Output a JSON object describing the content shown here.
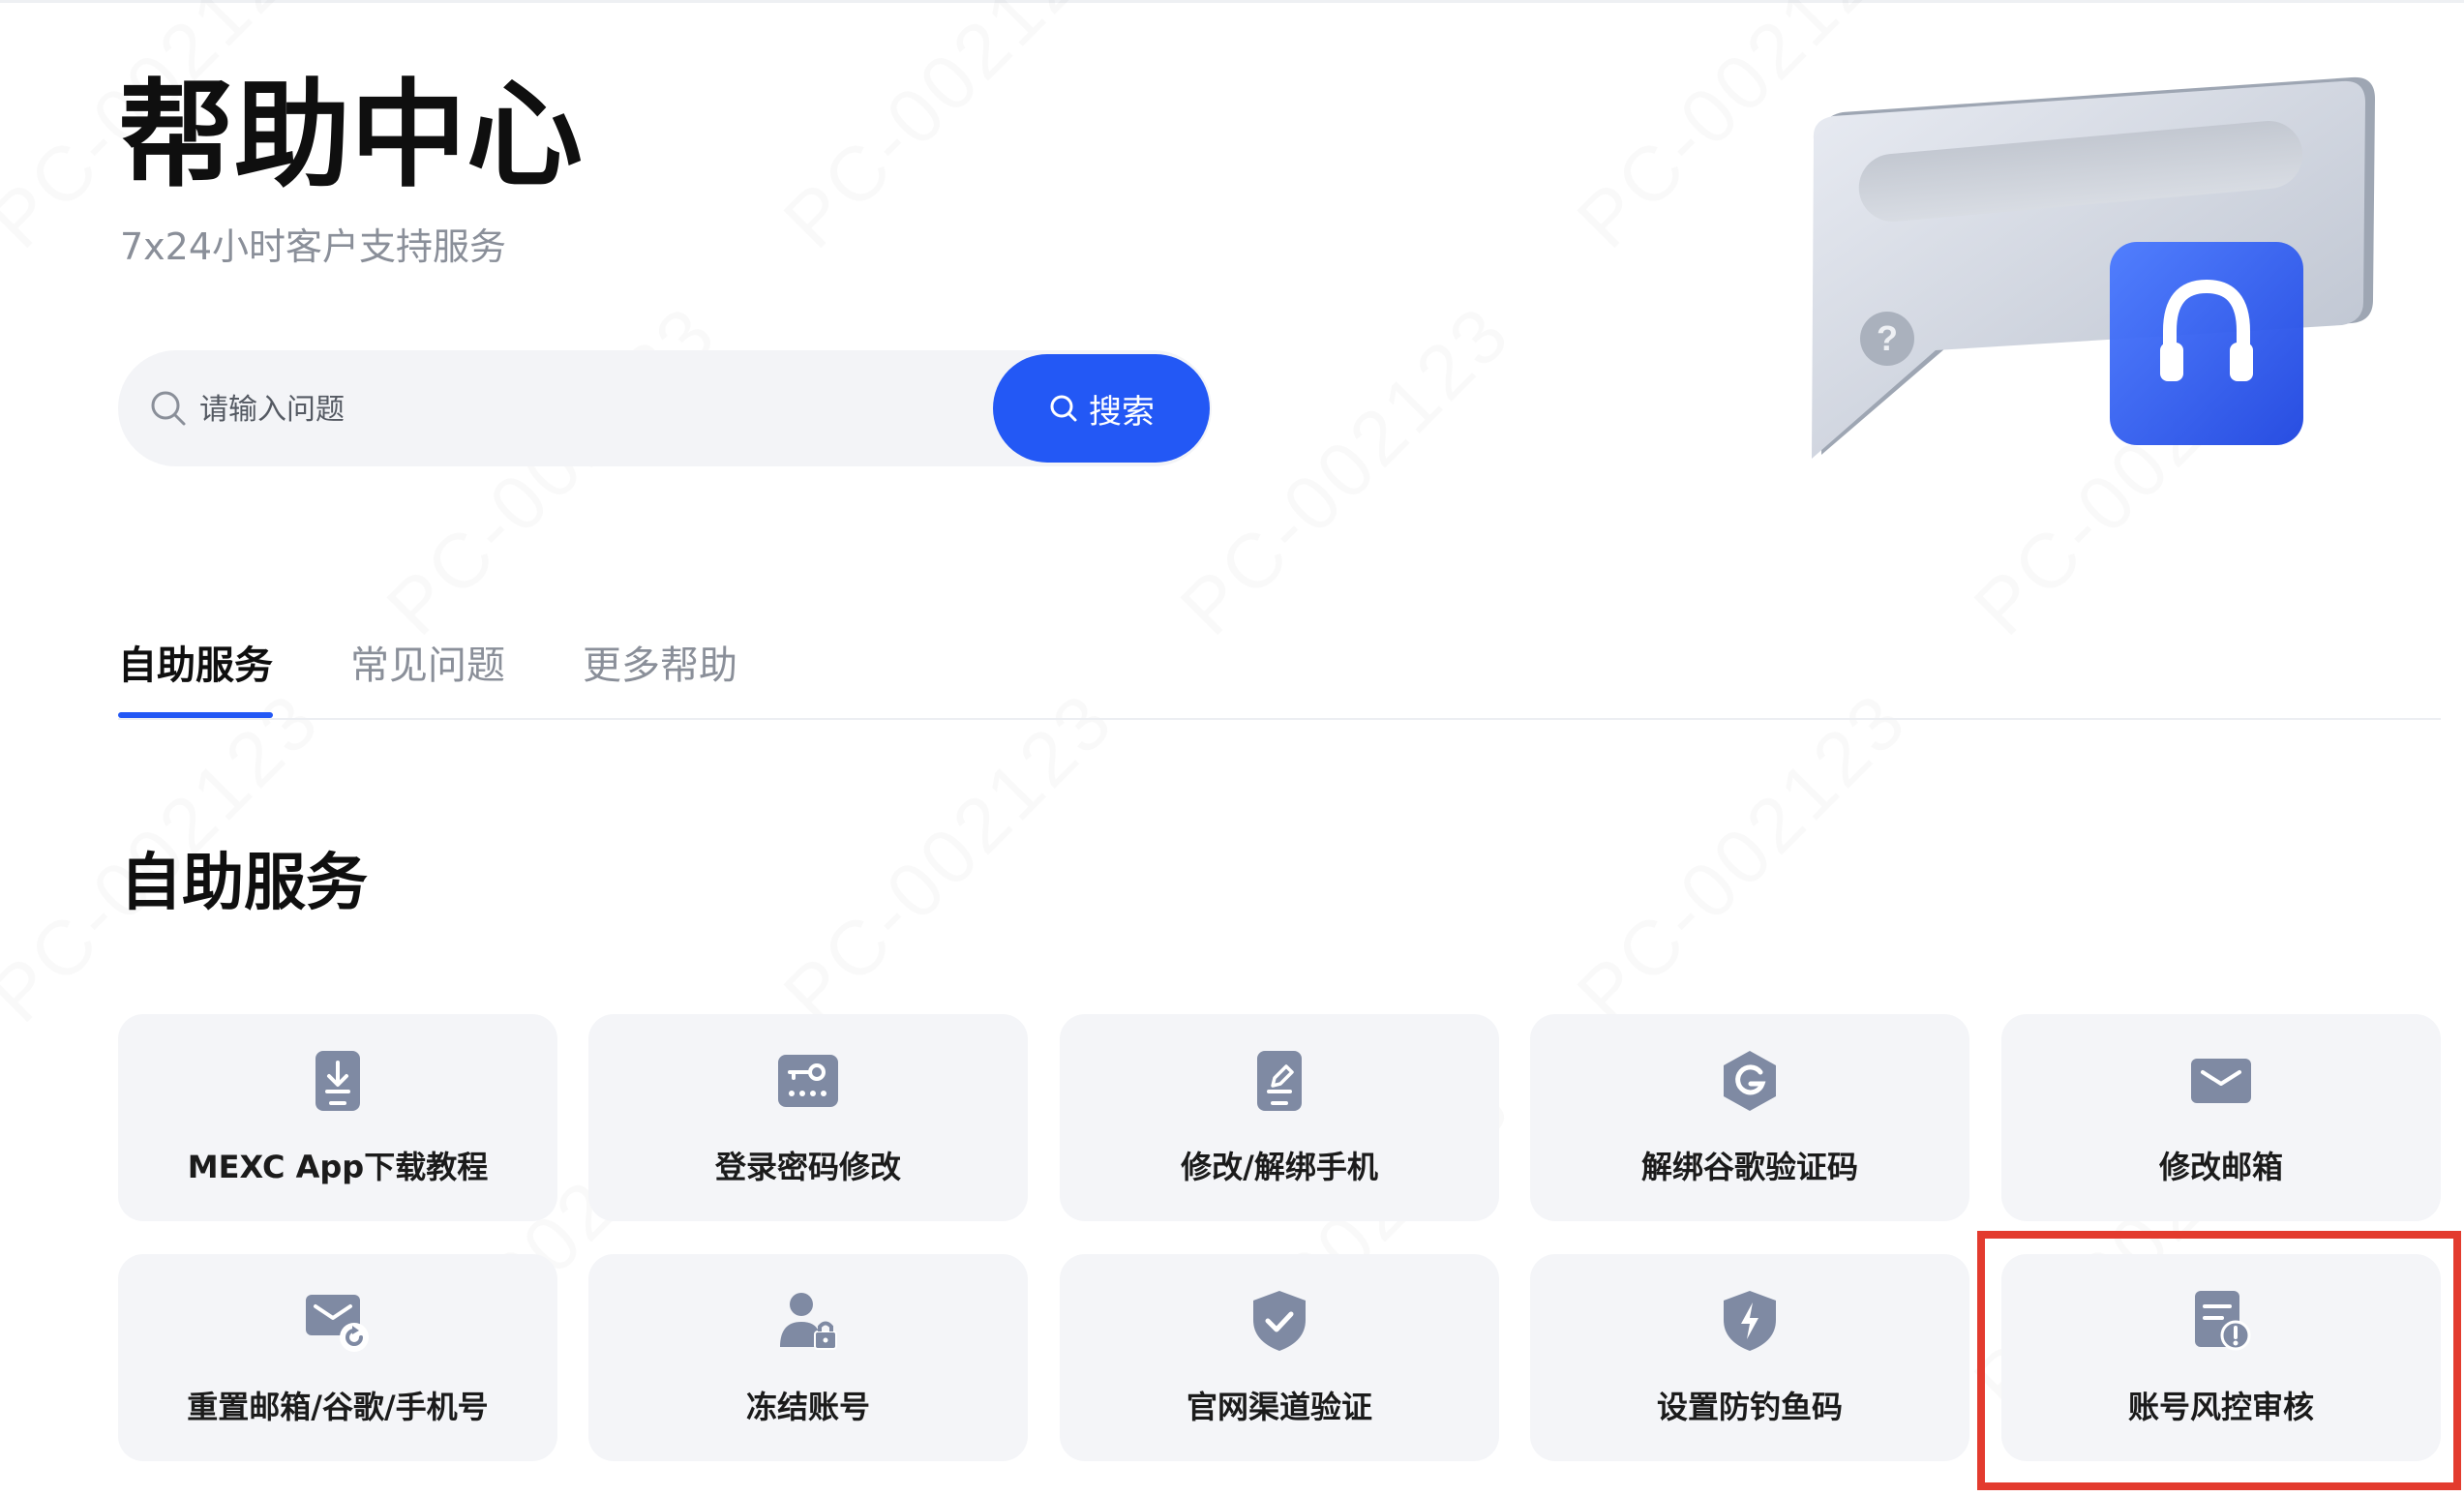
{
  "page": {
    "title": "帮助中心",
    "subtitle": "7x24小时客户支持服务"
  },
  "search": {
    "placeholder": "请输入问题",
    "value": "",
    "button_label": "搜索"
  },
  "tabs": [
    {
      "label": "自助服务",
      "active": true
    },
    {
      "label": "常见问题",
      "active": false
    },
    {
      "label": "更多帮助",
      "active": false
    }
  ],
  "section": {
    "title": "自助服务"
  },
  "services": [
    {
      "label": "MEXC App下载教程",
      "icon": "download-icon"
    },
    {
      "label": "登录密码修改",
      "icon": "password-key-icon"
    },
    {
      "label": "修改/解绑手机",
      "icon": "phone-edit-icon"
    },
    {
      "label": "解绑谷歌验证码",
      "icon": "google-icon"
    },
    {
      "label": "修改邮箱",
      "icon": "mail-icon"
    },
    {
      "label": "重置邮箱/谷歌/手机号",
      "icon": "mail-reset-icon"
    },
    {
      "label": "冻结账号",
      "icon": "user-lock-icon"
    },
    {
      "label": "官网渠道验证",
      "icon": "shield-check-icon"
    },
    {
      "label": "设置防钓鱼码",
      "icon": "shield-bolt-icon"
    },
    {
      "label": "账号风控审核",
      "icon": "document-alert-icon"
    }
  ],
  "watermark": "PC-002123",
  "colors": {
    "accent": "#2358f5",
    "card_background": "#f4f5f8",
    "icon_color": "#7f8aa3",
    "highlight": "#e33b2e"
  }
}
